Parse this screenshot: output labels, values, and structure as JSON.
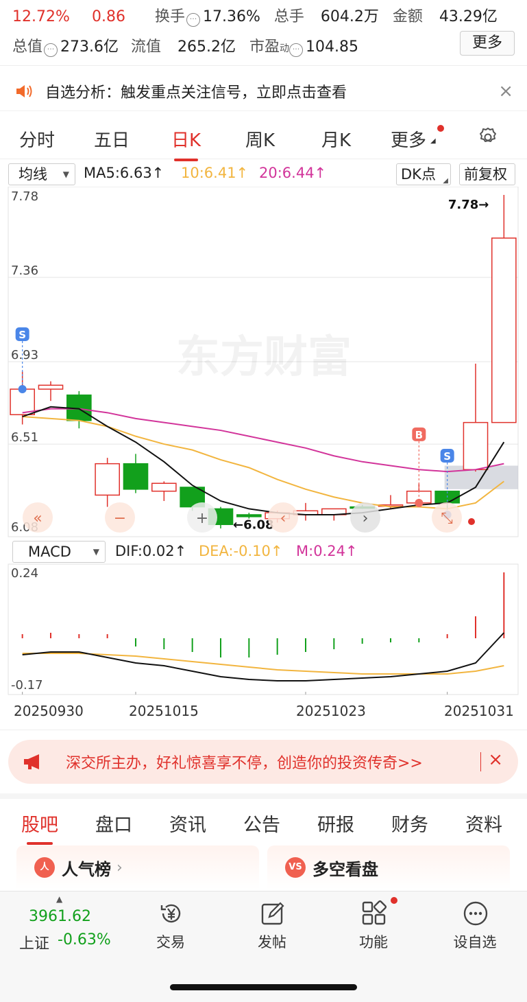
{
  "quote": {
    "change_pct": "12.72%",
    "change_amt": "0.86",
    "turnover_label": "换手",
    "turnover_value": "17.36%",
    "volume_label": "总手",
    "volume_value": "604.2万",
    "amount_label": "金额",
    "amount_value": "43.29亿",
    "mktcap_label": "总值",
    "mktcap_value": "273.6亿",
    "float_label": "流值",
    "float_value": "265.2亿",
    "pe_label": "市盈",
    "pe_sup": "动",
    "pe_value": "104.85",
    "more_label": "更多"
  },
  "notice": {
    "text": "自选分析：触发重点关注信号，立即点击查看",
    "close": "×"
  },
  "ktabs": [
    "分时",
    "五日",
    "日K",
    "周K",
    "月K",
    "更多"
  ],
  "ktab_active": 2,
  "ma": {
    "selector": "均线",
    "ma5": "MA5:6.63↑",
    "ma10": "10:6.41↑",
    "ma20": "20:6.44↑",
    "dk_label": "DK点",
    "fq_label": "前复权",
    "color_ma5": "#111111",
    "color_ma10": "#f2b53f",
    "color_ma20": "#d2349a"
  },
  "macd": {
    "selector": "MACD",
    "dif": "DIF:0.02↑",
    "dea": "DEA:-0.10↑",
    "m": "M:0.24↑",
    "axis_top": "0.24",
    "axis_bottom": "-0.17"
  },
  "chart_data": {
    "type": "candlestick",
    "y_axis_labels": [
      "7.78",
      "7.36",
      "6.93",
      "6.51",
      "6.08"
    ],
    "ylim": [
      6.08,
      7.78
    ],
    "max_label": "7.78→",
    "min_label": "←6.08",
    "candles": [
      {
        "o": 6.66,
        "h": 6.88,
        "l": 6.61,
        "c": 6.79,
        "up": true
      },
      {
        "o": 6.79,
        "h": 6.83,
        "l": 6.73,
        "c": 6.81,
        "up": true
      },
      {
        "o": 6.76,
        "h": 6.78,
        "l": 6.59,
        "c": 6.63,
        "up": false
      },
      {
        "o": 6.25,
        "h": 6.44,
        "l": 6.19,
        "c": 6.41,
        "up": true
      },
      {
        "o": 6.41,
        "h": 6.46,
        "l": 6.26,
        "c": 6.28,
        "up": false
      },
      {
        "o": 6.27,
        "h": 6.32,
        "l": 6.22,
        "c": 6.31,
        "up": true
      },
      {
        "o": 6.29,
        "h": 6.29,
        "l": 6.17,
        "c": 6.19,
        "up": false
      },
      {
        "o": 6.18,
        "h": 6.19,
        "l": 6.08,
        "c": 6.1,
        "up": false
      },
      {
        "o": 6.15,
        "h": 6.16,
        "l": 6.13,
        "c": 6.14,
        "up": false
      },
      {
        "o": 6.13,
        "h": 6.17,
        "l": 6.11,
        "c": 6.16,
        "up": true
      },
      {
        "o": 6.15,
        "h": 6.21,
        "l": 6.12,
        "c": 6.17,
        "up": true
      },
      {
        "o": 6.15,
        "h": 6.18,
        "l": 6.12,
        "c": 6.18,
        "up": true
      },
      {
        "o": 6.19,
        "h": 6.2,
        "l": 6.18,
        "c": 6.19,
        "up": false
      },
      {
        "o": 6.2,
        "h": 6.25,
        "l": 6.18,
        "c": 6.2,
        "up": true
      },
      {
        "o": 6.21,
        "h": 6.31,
        "l": 6.2,
        "c": 6.27,
        "up": true
      },
      {
        "o": 6.27,
        "h": 6.27,
        "l": 6.18,
        "c": 6.21,
        "up": false
      },
      {
        "o": 6.38,
        "h": 6.92,
        "l": 6.37,
        "c": 6.62,
        "up": true
      },
      {
        "o": 6.62,
        "h": 7.78,
        "l": 6.62,
        "c": 7.56,
        "up": true
      }
    ],
    "ma5": [
      6.65,
      6.7,
      6.69,
      6.6,
      6.52,
      6.42,
      6.3,
      6.22,
      6.18,
      6.16,
      6.15,
      6.15,
      6.16,
      6.18,
      6.2,
      6.21,
      6.29,
      6.52
    ],
    "ma10": [
      6.65,
      6.64,
      6.63,
      6.6,
      6.55,
      6.51,
      6.48,
      6.43,
      6.39,
      6.33,
      6.28,
      6.24,
      6.21,
      6.19,
      6.19,
      6.18,
      6.21,
      6.32
    ],
    "ma20": [
      6.67,
      6.69,
      6.69,
      6.67,
      6.64,
      6.62,
      6.6,
      6.58,
      6.55,
      6.52,
      6.49,
      6.45,
      6.42,
      6.4,
      6.38,
      6.37,
      6.38,
      6.41
    ],
    "macd_hist": [
      0.0,
      0.02,
      0.01,
      0.0,
      -0.03,
      -0.04,
      -0.05,
      -0.07,
      -0.07,
      -0.06,
      -0.05,
      -0.04,
      -0.02,
      -0.01,
      -0.01,
      0.01,
      0.08,
      0.24
    ],
    "macd_dif": [
      -0.06,
      -0.05,
      -0.05,
      -0.07,
      -0.09,
      -0.1,
      -0.12,
      -0.14,
      -0.15,
      -0.155,
      -0.155,
      -0.15,
      -0.145,
      -0.14,
      -0.13,
      -0.12,
      -0.09,
      0.02
    ],
    "macd_dea": [
      -0.055,
      -0.055,
      -0.055,
      -0.06,
      -0.065,
      -0.075,
      -0.085,
      -0.095,
      -0.105,
      -0.115,
      -0.12,
      -0.125,
      -0.13,
      -0.13,
      -0.13,
      -0.13,
      -0.12,
      -0.1
    ],
    "macd_ylim": [
      -0.17,
      0.24
    ],
    "x_labels": [
      "20250930",
      "20251015",
      "20251023",
      "20251031"
    ],
    "watermark": "东方财富",
    "signal_s": "S",
    "signal_b": "B"
  },
  "promo": {
    "text": "深交所主办，好礼惊喜享不停，创造你的投资传奇>>",
    "close": "×"
  },
  "stabs": [
    "股吧",
    "盘口",
    "资讯",
    "公告",
    "研报",
    "财务",
    "资料"
  ],
  "stab_active": 0,
  "cards": [
    {
      "icon": "人",
      "label": "人气榜",
      "chev": "›"
    },
    {
      "icon": "VS",
      "label": "多空看盘",
      "chev": ""
    }
  ],
  "bottom": {
    "index_value": "3961.62",
    "index_name": "上证",
    "index_change": "-0.63%",
    "items": [
      "交易",
      "发帖",
      "功能",
      "设自选"
    ]
  }
}
